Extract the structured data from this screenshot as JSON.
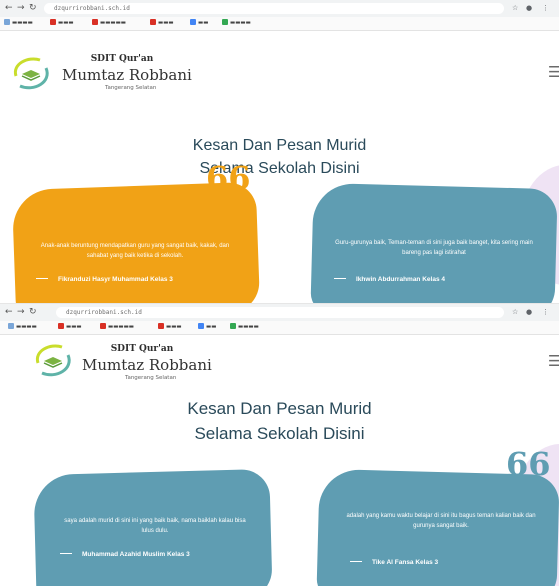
{
  "browser": {
    "url": "dzqurrirobbani.sch.id"
  },
  "site": {
    "brand_line1": "SDIT Qur'an",
    "brand_line2": "Mumtaz Robbani",
    "brand_line3": "Tangerang Selatan"
  },
  "section": {
    "title_line1": "Kesan Dan Pesan Murid",
    "title_line2": "Selama Sekolah Disini"
  },
  "quote_mark": "66",
  "colors": {
    "orange_card": "#f1a216",
    "teal_card": "#5f9db2",
    "heading": "#2a4a5a"
  },
  "testimonials_top": [
    {
      "text": "Anak-anak beruntung mendapatkan guru yang sangat baik, kakak, dan sahabat yang baik ketika di sekolah.",
      "author": "Fikranduzi Hasyr Muhammad Kelas 3"
    },
    {
      "text": "Guru-gurunya baik, Teman-teman di sini juga baik banget, kita sering main bareng pas lagi istirahat",
      "author": "Ikhwin Abdurrahman Kelas 4"
    }
  ],
  "testimonials_bottom": [
    {
      "text": "saya adalah murid di sini ini yang baik baik, nama baiklah kalau bisa lulus dulu.",
      "author": "Muhammad Azahid Muslim Kelas 3"
    },
    {
      "text": "adalah yang kamu waktu belajar di sini itu bagus teman kalian baik dan gurunya sangat baik.",
      "author": "Tike Al Fansa Kelas 3"
    }
  ]
}
